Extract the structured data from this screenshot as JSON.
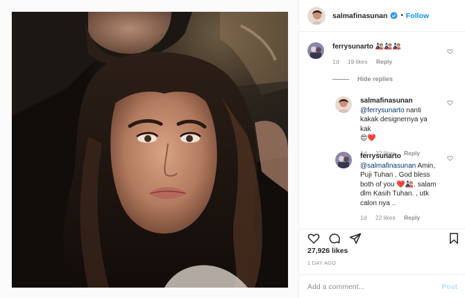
{
  "header": {
    "username": "salmafinasunan",
    "separator": "•",
    "follow_label": "Follow",
    "verified_icon": "verified-badge-icon",
    "accent_color": "#0095f6"
  },
  "comments": [
    {
      "username": "ferrysunarto",
      "text": "🎎🎎🎎",
      "time": "1d",
      "likes": "19 likes",
      "reply_label": "Reply"
    }
  ],
  "hide_replies_label": "Hide replies",
  "replies": [
    {
      "username": "salmafinasunan",
      "mention": "@ferrysunarto",
      "text": "nanti kakak designernya ya kak",
      "emoji": "😍❤️",
      "time": "1d",
      "likes": "32 likes",
      "reply_label": "Reply"
    },
    {
      "username": "ferrysunarto",
      "mention": "@salmafinasunan",
      "text_a": "Amin, Puji Tuhan , God bless both of you",
      "emoji": "❤️🎎",
      "text_b": ". salam dlm Kasih Tuhan. , utk calon nya ..",
      "time": "1d",
      "likes": "22 likes",
      "reply_label": "Reply"
    }
  ],
  "actions": {
    "icons": [
      "heart-icon",
      "comment-icon",
      "share-icon",
      "bookmark-icon"
    ]
  },
  "likes_count": "27,926 likes",
  "time_ago": "1 DAY AGO",
  "add_comment": {
    "placeholder": "Add a comment...",
    "post_label": "Post"
  }
}
